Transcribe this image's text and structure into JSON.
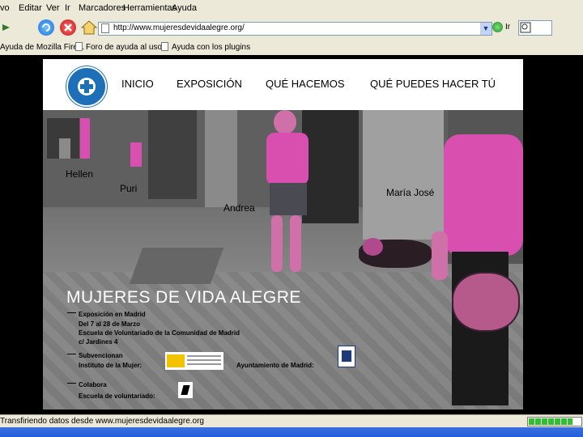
{
  "browser": {
    "menu": [
      "vo",
      "Editar",
      "Ver",
      "Ir",
      "Marcadores",
      "Herramientas",
      "Ayuda"
    ],
    "address": "http://www.mujeresdevidaalegre.org/",
    "go_label": "Ir",
    "bookmarks": [
      "Ayuda de Mozilla Fire...",
      "Foro de ayuda al uso",
      "Ayuda con los plugins"
    ],
    "status": "Transfiriendo datos desde www.mujeresdevidaalegre.org",
    "progress": 0.85
  },
  "site": {
    "nav": [
      "INICIO",
      "EXPOSICIÓN",
      "QUÉ HACEMOS",
      "QUÉ PUEDES HACER TÚ"
    ],
    "captions": [
      "Hellen",
      "Puri",
      "Andrea",
      "María José"
    ],
    "title": "MUJERES DE VIDA ALEGRE",
    "expo": [
      "Exposición en Madrid",
      "Del 7 al 28 de Marzo",
      "Escuela de Voluntariado de la Comunidad de Madrid",
      "c/ Jardines 4"
    ],
    "subvencionan": [
      "Subvencionan",
      "Instituto de la Mujer:"
    ],
    "ayuntamiento": "Ayuntamiento de Madrid:",
    "colabora": [
      "Colabora",
      "Escuela de voluntariado:"
    ]
  }
}
